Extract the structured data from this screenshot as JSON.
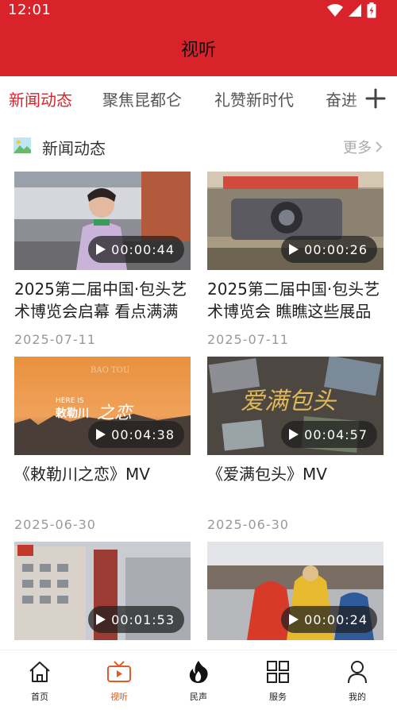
{
  "status_bar": {
    "time": "12:01"
  },
  "header": {
    "title": "视听"
  },
  "tabs": [
    {
      "label": "新闻动态",
      "active": true
    },
    {
      "label": "聚焦昆都仑",
      "active": false
    },
    {
      "label": "礼赞新时代",
      "active": false
    },
    {
      "label": "奋进",
      "active": false
    }
  ],
  "section": {
    "title": "新闻动态",
    "more_label": "更多"
  },
  "videos": [
    {
      "title": "2025第二届中国·包头艺术博览会启幕 看点满满",
      "duration": "00:00:44",
      "date": "2025-07-11"
    },
    {
      "title": "2025第二届中国·包头艺术博览会 瞧瞧这些展品",
      "duration": "00:00:26",
      "date": "2025-07-11"
    },
    {
      "title": "《敕勒川之恋》MV",
      "duration": "00:04:38",
      "date": "2025-06-30",
      "thumb_text": [
        "BAO TOU",
        "HERE IS",
        "敕勒川",
        "之恋"
      ]
    },
    {
      "title": "《爱满包头》MV",
      "duration": "00:04:57",
      "date": "2025-06-30",
      "thumb_text": "爱满包头"
    },
    {
      "title": "",
      "duration": "00:01:53",
      "date": ""
    },
    {
      "title": "",
      "duration": "00:00:24",
      "date": ""
    }
  ],
  "bottom_nav": [
    {
      "label": "首页",
      "icon": "home-icon",
      "active": false
    },
    {
      "label": "视听",
      "icon": "tv-play-icon",
      "active": true
    },
    {
      "label": "民声",
      "icon": "flame-icon",
      "active": false
    },
    {
      "label": "服务",
      "icon": "grid-icon",
      "active": false
    },
    {
      "label": "我的",
      "icon": "person-icon",
      "active": false
    }
  ],
  "colors": {
    "brand_red": "#d9232b",
    "active_nav": "#e35a25",
    "muted": "#999999"
  }
}
